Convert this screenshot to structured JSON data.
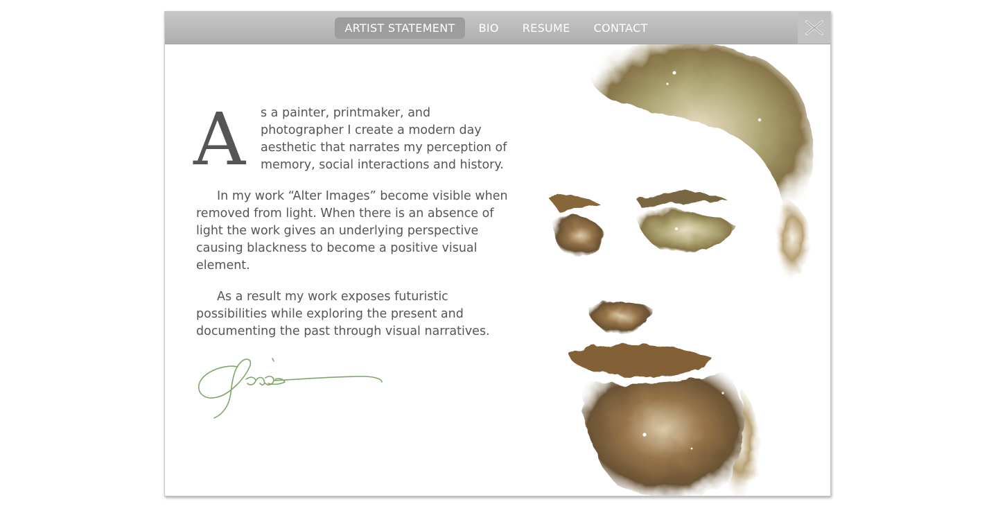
{
  "nav": {
    "items": [
      {
        "label": "ARTIST STATEMENT",
        "active": true
      },
      {
        "label": "BIO",
        "active": false
      },
      {
        "label": "RESUME",
        "active": false
      },
      {
        "label": "CONTACT",
        "active": false
      }
    ],
    "close_icon": "close-icon"
  },
  "statement": {
    "dropcap": "A",
    "lead": "s a painter, printmaker, and photographer I create a modern day aesthetic that narrates my perception of memory, social interactions and history.",
    "paragraphs": [
      "In my work “Alter Images” become visible when removed from light. When there is an absence of light the work gives an underlying perspective causing blackness to become a positive visual element.",
      "As a result my work exposes futuristic possibilities while exploring the present and documenting the past through visual narratives."
    ]
  },
  "colors": {
    "nav_bg": "#b5b5b5",
    "nav_active": "#9d9d9d",
    "text": "#555555",
    "signature": "#7fa56a"
  },
  "signature_icon": "signature-image",
  "portrait_icon": "portrait-image"
}
